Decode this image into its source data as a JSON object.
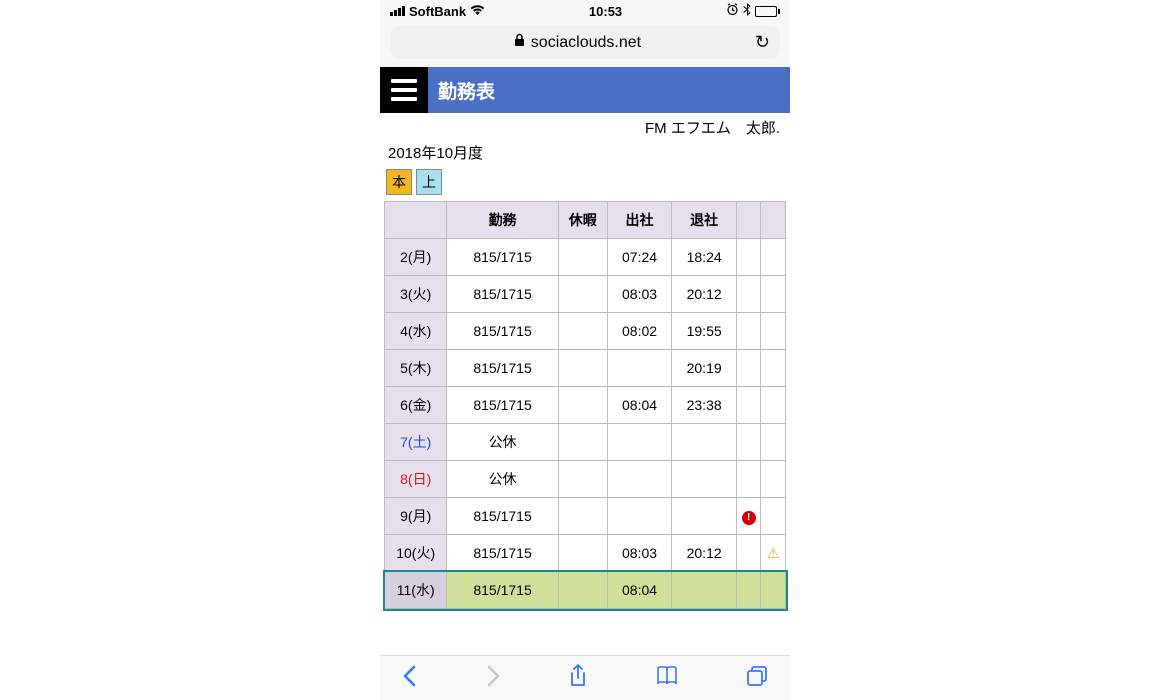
{
  "status": {
    "carrier": "SoftBank",
    "time": "10:53"
  },
  "url": "sociaclouds.net",
  "header": {
    "title": "勤務表"
  },
  "user": "FM エフエム　太郎.",
  "period": "2018年10月度",
  "chips": {
    "a": "本",
    "b": "上"
  },
  "columns": {
    "work": "勤務",
    "holiday": "休暇",
    "in": "出社",
    "out": "退社"
  },
  "rows": [
    {
      "date": "2(月)",
      "work": "815/1715",
      "hol": "",
      "in": "07:24",
      "out": "18:24",
      "s1": "",
      "s2": ""
    },
    {
      "date": "3(火)",
      "work": "815/1715",
      "hol": "",
      "in": "08:03",
      "out": "20:12",
      "s1": "",
      "s2": ""
    },
    {
      "date": "4(水)",
      "work": "815/1715",
      "hol": "",
      "in": "08:02",
      "out": "19:55",
      "s1": "",
      "s2": ""
    },
    {
      "date": "5(木)",
      "work": "815/1715",
      "hol": "",
      "in": "",
      "out": "20:19",
      "s1": "",
      "s2": ""
    },
    {
      "date": "6(金)",
      "work": "815/1715",
      "hol": "",
      "in": "08:04",
      "out": "23:38",
      "s1": "",
      "s2": ""
    },
    {
      "date": "7(土)",
      "work": "公休",
      "hol": "",
      "in": "",
      "out": "",
      "s1": "",
      "s2": "",
      "cls": "sat"
    },
    {
      "date": "8(日)",
      "work": "公休",
      "hol": "",
      "in": "",
      "out": "",
      "s1": "",
      "s2": "",
      "cls": "sun"
    },
    {
      "date": "9(月)",
      "work": "815/1715",
      "hol": "",
      "in": "",
      "out": "",
      "s1": "err",
      "s2": ""
    },
    {
      "date": "10(火)",
      "work": "815/1715",
      "hol": "",
      "in": "08:03",
      "out": "20:12",
      "s1": "",
      "s2": "warn"
    },
    {
      "date": "11(水)",
      "work": "815/1715",
      "hol": "",
      "in": "08:04",
      "out": "",
      "s1": "",
      "s2": "",
      "today": true
    }
  ]
}
